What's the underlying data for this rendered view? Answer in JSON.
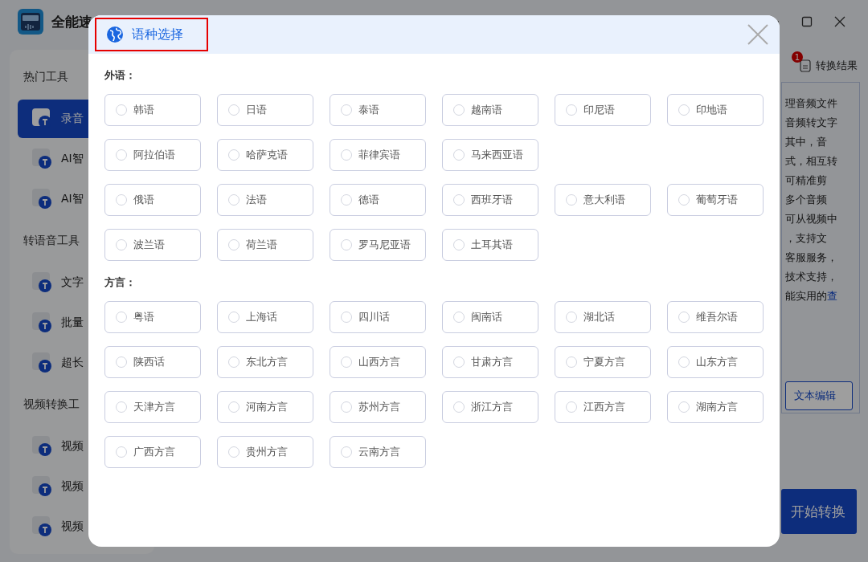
{
  "app": {
    "title": "全能速"
  },
  "sidebar": {
    "sections": [
      {
        "heading": "热门工具",
        "items": [
          {
            "label": "录音",
            "selected": true
          },
          {
            "label": "AI智",
            "selected": false
          },
          {
            "label": "AI智",
            "selected": false
          }
        ]
      },
      {
        "heading": "转语音工具",
        "items": [
          {
            "label": "文字",
            "selected": false
          },
          {
            "label": "批量",
            "selected": false
          },
          {
            "label": "超长",
            "selected": false
          }
        ]
      },
      {
        "heading": "视频转换工",
        "items": [
          {
            "label": "视频",
            "selected": false
          },
          {
            "label": "视频",
            "selected": false
          },
          {
            "label": "视频",
            "selected": false
          }
        ]
      }
    ]
  },
  "results": {
    "label": "转换结果",
    "badge": "1"
  },
  "description": {
    "lines": [
      "理音频文件",
      "音频转文字",
      "其中，音",
      "式，相互转",
      "可精准剪",
      "多个音频",
      "可从视频中",
      "，支持文",
      "客服服务，",
      "技术支持，",
      "能实用的"
    ],
    "link": "查"
  },
  "buttons": {
    "edit": "文本编辑",
    "start": "开始转换"
  },
  "dialog": {
    "title": "语种选择",
    "highlighted": true,
    "sections": [
      {
        "heading": "外语：",
        "rows": [
          [
            {
              "label": "韩语",
              "selected": false
            },
            {
              "label": "日语",
              "selected": false
            },
            {
              "label": "泰语",
              "selected": false
            },
            {
              "label": "越南语",
              "selected": false
            },
            {
              "label": "印尼语",
              "selected": false
            },
            {
              "label": "印地语",
              "selected": false
            }
          ],
          [
            {
              "label": "阿拉伯语",
              "selected": false
            },
            {
              "label": "哈萨克语",
              "selected": false
            },
            {
              "label": "菲律宾语",
              "selected": false
            },
            {
              "label": "马来西亚语",
              "selected": false
            }
          ],
          [
            {
              "label": "俄语",
              "selected": false
            },
            {
              "label": "法语",
              "selected": false
            },
            {
              "label": "德语",
              "selected": false
            },
            {
              "label": "西班牙语",
              "selected": false
            },
            {
              "label": "意大利语",
              "selected": false
            },
            {
              "label": "葡萄牙语",
              "selected": false
            }
          ],
          [
            {
              "label": "波兰语",
              "selected": false
            },
            {
              "label": "荷兰语",
              "selected": false
            },
            {
              "label": "罗马尼亚语",
              "selected": false
            },
            {
              "label": "土耳其语",
              "selected": false
            }
          ]
        ]
      },
      {
        "heading": "方言：",
        "rows": [
          [
            {
              "label": "粤语",
              "selected": false
            },
            {
              "label": "上海话",
              "selected": false
            },
            {
              "label": "四川话",
              "selected": false
            },
            {
              "label": "闽南话",
              "selected": false
            },
            {
              "label": "湖北话",
              "selected": false
            },
            {
              "label": "维吾尔语",
              "selected": false
            }
          ],
          [
            {
              "label": "陕西话",
              "selected": false
            },
            {
              "label": "东北方言",
              "selected": false
            },
            {
              "label": "山西方言",
              "selected": false
            },
            {
              "label": "甘肃方言",
              "selected": false
            },
            {
              "label": "宁夏方言",
              "selected": false
            },
            {
              "label": "山东方言",
              "selected": false
            }
          ],
          [
            {
              "label": "天津方言",
              "selected": false
            },
            {
              "label": "河南方言",
              "selected": false
            },
            {
              "label": "苏州方言",
              "selected": false
            },
            {
              "label": "浙江方言",
              "selected": false
            },
            {
              "label": "江西方言",
              "selected": false
            },
            {
              "label": "湖南方言",
              "selected": false
            }
          ],
          [
            {
              "label": "广西方言",
              "selected": false
            },
            {
              "label": "贵州方言",
              "selected": false
            },
            {
              "label": "云南方言",
              "selected": false
            }
          ]
        ]
      }
    ]
  }
}
